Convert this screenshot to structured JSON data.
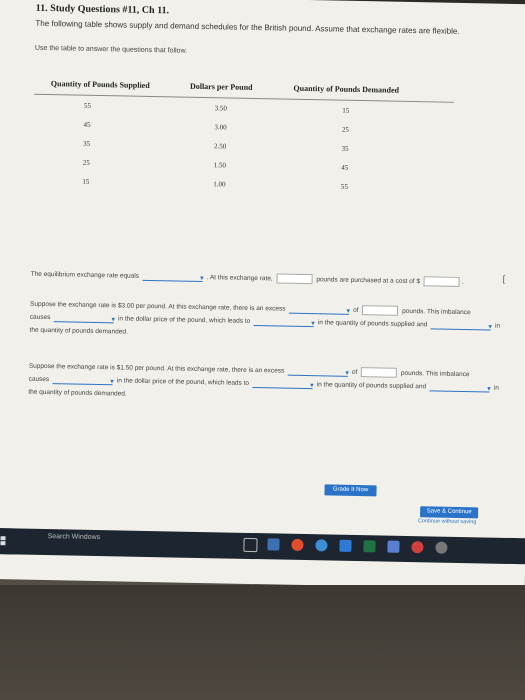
{
  "title": "11. Study Questions #11, Ch 11.",
  "intro": "The following table shows supply and demand schedules for the British pound. Assume that exchange rates are flexible.",
  "instruction": "Use the table to answer the questions that follow.",
  "table": {
    "headers": [
      "Quantity of Pounds Supplied",
      "Dollars per Pound",
      "Quantity of Pounds Demanded"
    ],
    "rows": [
      [
        "55",
        "3.50",
        "15"
      ],
      [
        "45",
        "3.00",
        "25"
      ],
      [
        "35",
        "2.50",
        "35"
      ],
      [
        "25",
        "1.50",
        "45"
      ],
      [
        "15",
        "1.00",
        "55"
      ]
    ]
  },
  "q1": {
    "a": "The equilibrium exchange rate equals",
    "b": ". At this exchange rate,",
    "c": "pounds are purchased at a cost of $",
    "d": "."
  },
  "q2": {
    "a": "Suppose the exchange rate is $3.00 per pound. At this exchange rate, there is an excess",
    "b": "of",
    "c": "pounds. This imbalance",
    "d": "causes",
    "e": "in the dollar price of the pound, which leads to",
    "f": "in the quantity of pounds supplied and",
    "g": "in",
    "h": "the quantity of pounds demanded."
  },
  "q3": {
    "a": "Suppose the exchange rate is $1.50 per pound. At this exchange rate, there is an excess",
    "b": "of",
    "c": "pounds. This imbalance",
    "d": "causes",
    "e": "in the dollar price of the pound, which leads to",
    "f": "in the quantity of pounds supplied and",
    "g": "in",
    "h": "the quantity of pounds demanded."
  },
  "buttons": {
    "grade": "Grade It Now",
    "save": "Save & Continue",
    "continue": "Continue without saving"
  },
  "taskbar": {
    "search": "Search Windows"
  },
  "right_mark": "["
}
